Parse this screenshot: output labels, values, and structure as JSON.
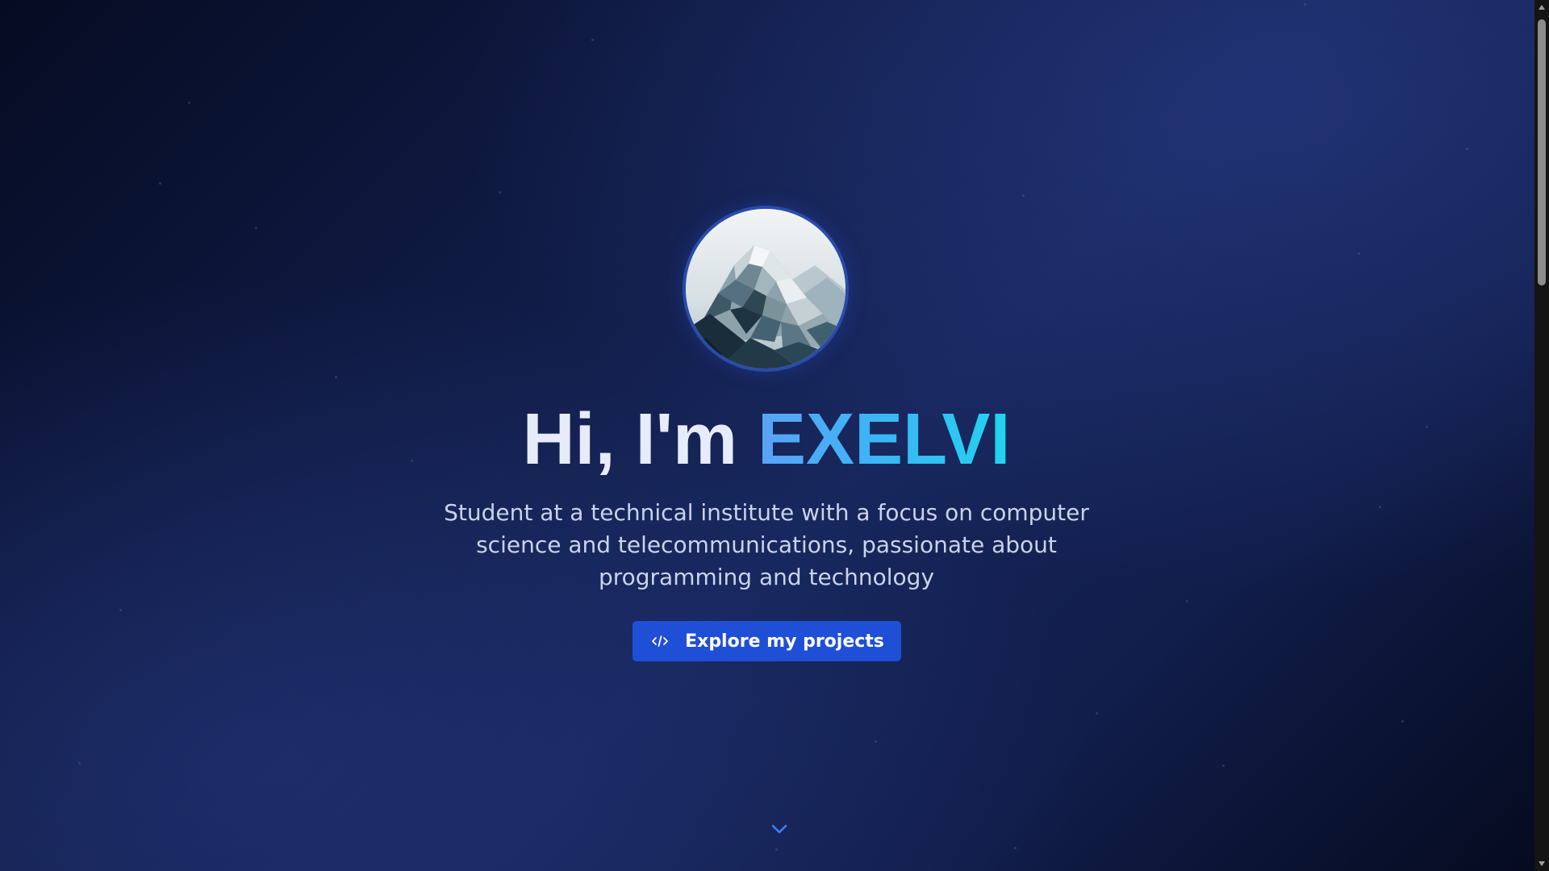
{
  "hero": {
    "avatar_alt": "Low-poly snowy mountain avatar",
    "title_prefix": "Hi, I'm ",
    "title_name": "EXELVI",
    "subtitle": "Student at a technical institute with a focus on computer science and telecommunications, passionate about programming and technology",
    "cta_label": "Explore my projects",
    "cta_icon": "code-icon",
    "scroll_icon": "chevron-down-icon"
  },
  "colors": {
    "background_dark": "#060b22",
    "background_mid": "#162559",
    "title_text": "#e6ecfb",
    "accent_gradient_start": "#5aa2f7",
    "accent_gradient_end": "#22d3ee",
    "button": "#1f4fd6",
    "subtitle_text": "#c9d3ea"
  }
}
